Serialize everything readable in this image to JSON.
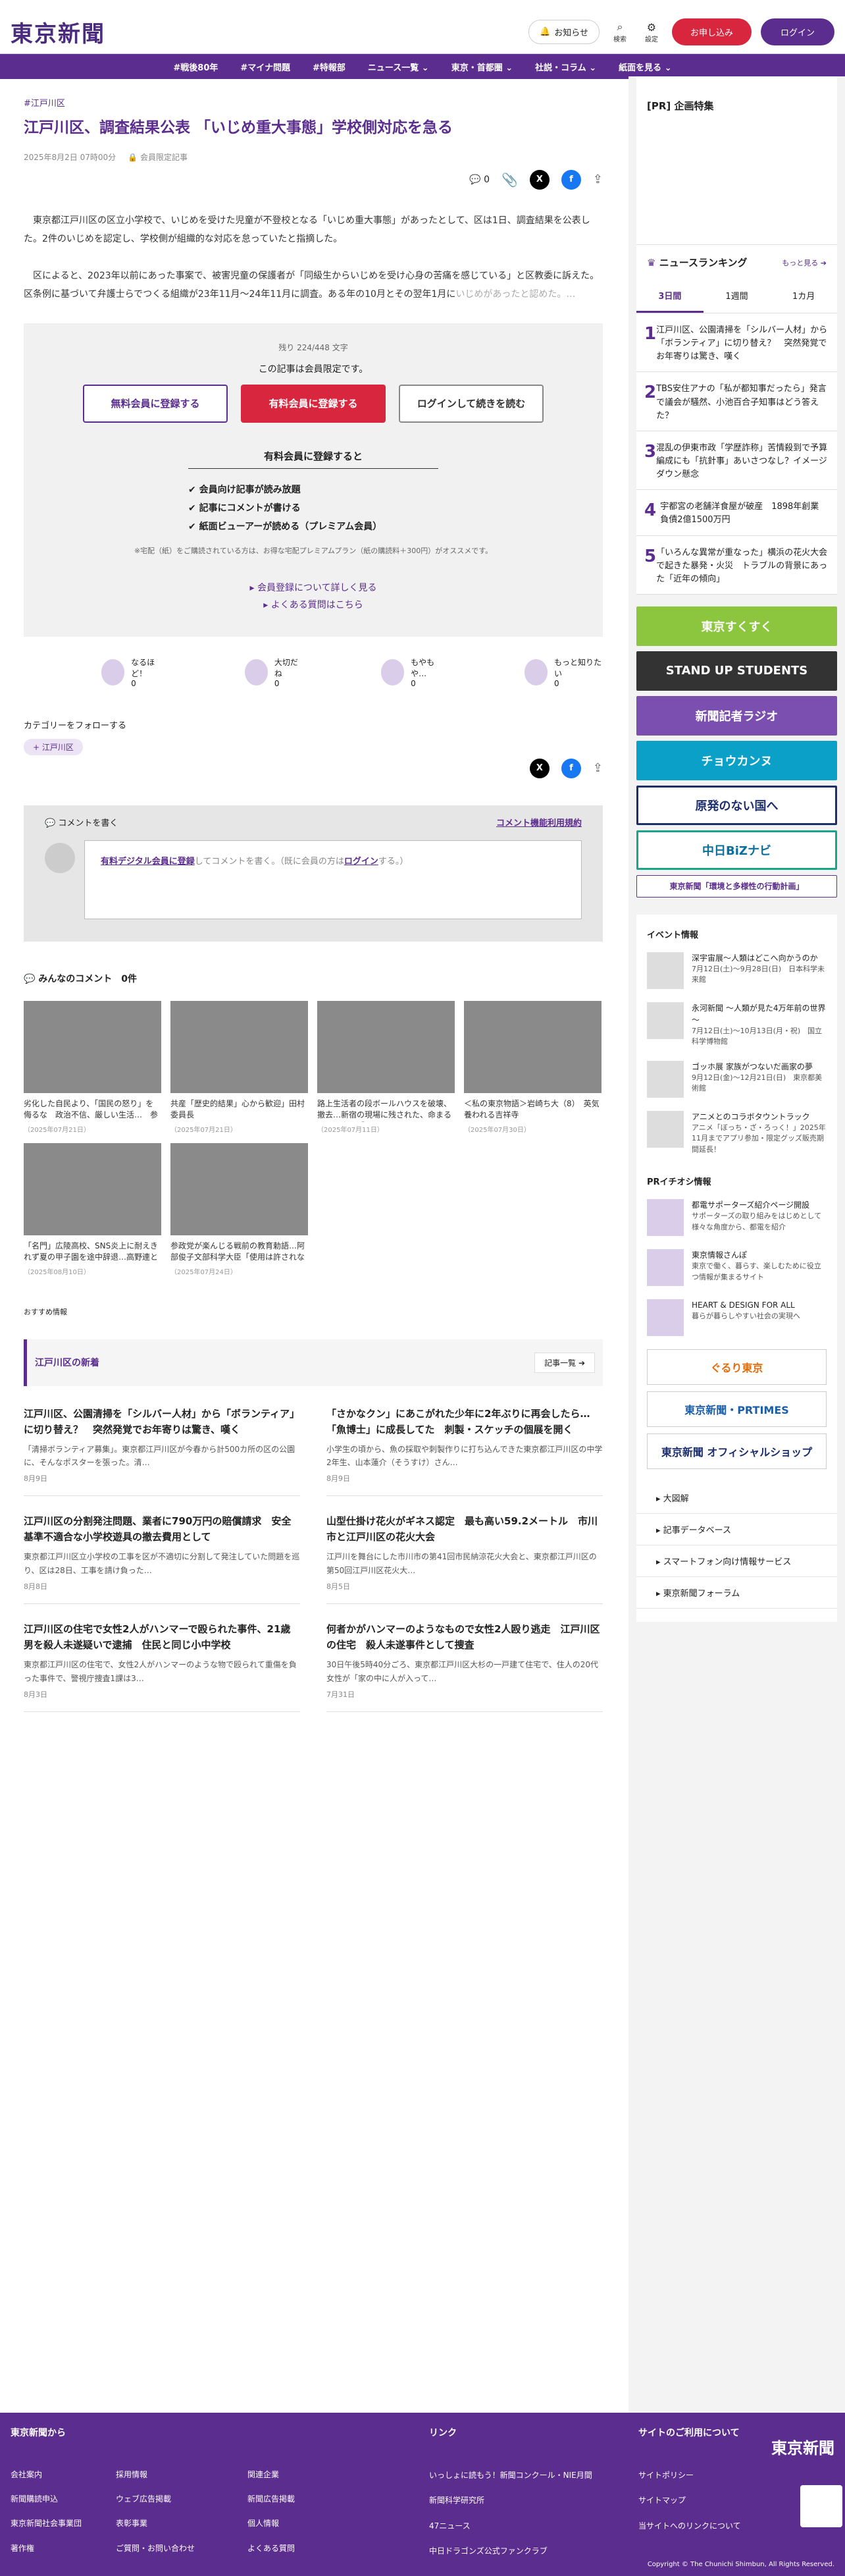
{
  "header": {
    "logo": "東京新聞",
    "notice": "お知らせ",
    "search": "検索",
    "settings": "設定",
    "subscribe": "お申し込み",
    "login": "ログイン"
  },
  "nav": [
    "#戦後80年",
    "#マイナ問題",
    "#特報部",
    "ニュース一覧",
    "東京・首都圏",
    "社説・コラム",
    "紙面を見る"
  ],
  "article": {
    "tag": "#江戸川区",
    "title": "江戸川区、調査結果公表 「いじめ重大事態」学校側対応を急る",
    "date": "2025年8月2日 07時00分",
    "members_only": "会員限定記事",
    "comment_count": "0",
    "p1": "東京都江戸川区の区立小学校で、いじめを受けた児童が不登校となる「いじめ重大事態」があったとして、区は1日、調査結果を公表した。2件のいじめを認定し、学校側が組織的な対応を怠っていたと指摘した。",
    "p2": "区によると、2023年以前にあった事案で、被害児童の保護者が「同級生からいじめを受け心身の苦痛を感じている」と区教委に訴えた。区条例に基づいて弁護士らでつくる組織が23年11月～24年11月に調査。ある年の10月とその翌年1月に",
    "p2_fade": "いじめがあったと認めた。…"
  },
  "paywall": {
    "remain": "残り 224/448 文字",
    "lead": "この記事は会員限定です。",
    "btn_free": "無料会員に登録する",
    "btn_paid": "有料会員に登録する",
    "btn_login": "ログインして続きを読む",
    "benefit_title": "有料会員に登録すると",
    "benefits": [
      "✔ 会員向け記事が読み放題",
      "✔ 記事にコメントが書ける",
      "✔ 紙面ビューアーが読める（プレミアム会員）"
    ],
    "note": "※宅配（紙）をご購読されている方は、お得な宅配プレミアムプラン（紙の購読料＋300円）がオススメです。",
    "link1": "▸ 会員登録について詳しく見る",
    "link2": "▸ よくある質問はこちら"
  },
  "reactions": [
    {
      "label": "なるほど！",
      "count": "0"
    },
    {
      "label": "大切だね",
      "count": "0"
    },
    {
      "label": "もやもや…",
      "count": "0"
    },
    {
      "label": "もっと知りたい",
      "count": "0"
    }
  ],
  "category": {
    "heading": "カテゴリーをフォローする",
    "tag": "+ 江戸川区"
  },
  "comments": {
    "write": "コメントを書く",
    "rules": "コメント機能利用規約",
    "prompt_link": "有料デジタル会員に登録",
    "prompt_rest": "してコメントを書く。（既に会員の方は",
    "prompt_login": "ログイン",
    "prompt_end": "する。）",
    "all": "みんなのコメント　0件"
  },
  "photos": [
    {
      "cap": "劣化した自民より、「国民の怒り」を侮るな　政治不信、厳しい生活…　参院選の結果を受けて…",
      "dt": "（2025年07月21日）"
    },
    {
      "cap": "共産「歴史的結果」心から歓迎」田村委員長",
      "dt": "（2025年07月21日）"
    },
    {
      "cap": "路上生活者の段ボールハウスを破壊、撤去…新宿の現場に残された、命まるごとの声と「やり…",
      "dt": "（2025年07月11日）"
    },
    {
      "cap": "＜私の東京物語＞岩崎ち大（8）　英気養われる吉祥寺",
      "dt": "（2025年07月30日）"
    },
    {
      "cap": "「名門」広陵高校、SNS炎上に耐えきれず夏の甲子園を途中辞退…高野連ともども事争事案…",
      "dt": "（2025年08月10日）"
    },
    {
      "cap": "参政党が楽んじる戦前の教育勅語…阿部俊子文部科学大臣「使用は許されない」クギをさす…",
      "dt": "（2025年07月24日）"
    }
  ],
  "recommended": "おすすめ情報",
  "latest": {
    "title": "江戸川区の新着",
    "more": "記事一覧 ➔"
  },
  "news": [
    {
      "t": "江戸川区、公園清掃を「シルバー人材」から「ボランティア」に切り替え？　突然発覚でお年寄りは驚き、嘆く",
      "d": "「清掃ボランティア募集」。東京都江戸川区が今春から計500カ所の区の公園に、そんなポスターを張った。清…",
      "x": "8月9日"
    },
    {
      "t": "「さかなクン」にあこがれた少年に2年ぶりに再会したら…「魚博士」に成長してた　刺製・スケッチの個展を開く",
      "d": "小学生の頃から、魚の採取や刺製作りに打ち込んできた東京都江戸川区の中学2年生、山本蓮介（そうすけ）さん…",
      "x": "8月9日"
    },
    {
      "t": "江戸川区の分割発注問題、業者に790万円の賠償請求　安全基準不適合な小学校遊具の撤去費用として",
      "d": "東京都江戸川区立小学校の工事を区が不適切に分割して発注していた問題を巡り、区は28日、工事を請け負った…",
      "x": "8月8日"
    },
    {
      "t": "山型仕掛け花火がギネス認定　最も高い59.2メートル　市川市と江戸川区の花火大会",
      "d": "江戸川を舞台にした市川市の第41回市民納涼花火大会と、東京都江戸川区の第50回江戸川区花火大…",
      "x": "8月5日"
    },
    {
      "t": "江戸川区の住宅で女性2人がハンマーで殴られた事件、21歳男を殺人未遂疑いで逮捕　住民と同じ小中学校",
      "d": "東京都江戸川区の住宅で、女性2人がハンマーのような物で殴られて重傷を負った事件で、警視庁捜査1課は3…",
      "x": "8月3日"
    },
    {
      "t": "何者かがハンマーのようなもので女性2人殴り逃走　江戸川区の住宅　殺人未遂事件として捜査",
      "d": "30日午後5時40分ごろ、東京都江戸川区大杉の一戸建て住宅で、住人の20代女性が「家の中に人が入って…",
      "x": "7月31日"
    }
  ],
  "sidebar": {
    "pr_title": "[PR] 企画特集",
    "ranking_title": "ニュースランキング",
    "ranking_more": "もっと見る ➔",
    "tabs": [
      "3日間",
      "1週間",
      "1カ月"
    ],
    "ranking": [
      {
        "n": "1",
        "t": "江戸川区、公園清掃を「シルバー人材」から「ボランティア」に切り替え？　突然発覚でお年寄りは驚き、嘆く"
      },
      {
        "n": "2",
        "t": "TBS安住アナの「私が都知事だったら」発言で議会が騒然、小池百合子知事はどう答えた？"
      },
      {
        "n": "3",
        "t": "混乱の伊東市政「学歴詐称」苦情殺到で予算編成にも「抗針事」あいさつなし？イメージダウン懸念"
      },
      {
        "n": "4",
        "t": "宇都宮の老舗洋食屋が破産　1898年創業　負債2億1500万円"
      },
      {
        "n": "5",
        "t": "「いろんな異常が重なった」横浜の花火大会で起きた暴発・火災　トラブルの背景にあった「近年の傾向」"
      }
    ],
    "banners": [
      "東京すくすく",
      "STAND UP STUDENTS",
      "新聞記者ラジオ",
      "チョウカンヌ",
      "原発のない国へ",
      "中日BiZナビ",
      "東京新聞「環境と多様性の行動計画」"
    ],
    "event_title": "イベント情報",
    "events": [
      {
        "t": "深宇宙展～人類はどこへ向かうのか",
        "s": "7月12日(土)～9月28日(日)　日本科学未来館"
      },
      {
        "t": "永河新聞 ～人類が見た4万年前の世界～",
        "s": "7月12日(土)～10月13日(月・祝)　国立科学博物館"
      },
      {
        "t": "ゴッホ展 家族がつないだ画家の夢",
        "s": "9月12日(金)～12月21日(日)　東京都美術館"
      },
      {
        "t": "アニメとのコラボタウントラック",
        "s": "アニメ「ぼっち・ざ・ろっく！」2025年11月までアプリ参加・限定グッズ販売期間延長！"
      }
    ],
    "prn_title": "PRイチオシ情報",
    "prn": [
      {
        "t": "都電サポーターズ紹介ページ開設",
        "s": "サポーターズの取り組みをはじめとして様々な角度から、都電を紹介"
      },
      {
        "t": "東京情報さんぽ",
        "s": "東京で働く、暮らす、楽しむために役立つ情報が集まるサイト"
      },
      {
        "t": "HEART & DESIGN FOR ALL",
        "s": "暮らが暮らしやすい社会の実現へ"
      }
    ],
    "sb_banners": [
      "ぐるり東京",
      "東京新聞・PRTIMES",
      "東京新聞 オフィシャルショップ"
    ],
    "links": [
      "大図解",
      "記事データベース",
      "スマートフォン向け情報サービス",
      "東京新聞フォーラム"
    ]
  },
  "footer": {
    "col1_title": "東京新聞から",
    "col1": [
      "会社案内",
      "採用情報",
      "関連企業",
      "新聞購読申込",
      "ウェブ広告掲載",
      "新聞広告掲載",
      "東京新聞社会事業団",
      "表彰事業",
      "個人情報",
      "著作権",
      "ご質問・お問い合わせ",
      "よくある質問"
    ],
    "col2_title": "リンク",
    "col2": [
      "いっしょに読もう！新聞コンクール・NIE月間",
      "新聞科学研究所",
      "47ニュース",
      "中日ドラゴンズ公式ファンクラブ"
    ],
    "col3_title": "サイトのご利用について",
    "col3": [
      "サイトポリシー",
      "サイトマップ",
      "当サイトへのリンクについて"
    ],
    "logo": "東京新聞",
    "copyright": "Copyright © The Chunichi Shimbun, All Rights Reserved."
  },
  "colors": {
    "brand": "#5b2d8e",
    "accent": "#d7263d"
  }
}
